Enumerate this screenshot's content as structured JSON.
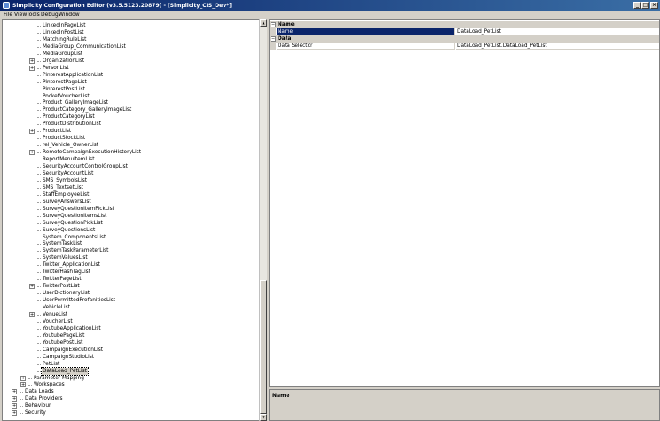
{
  "window": {
    "title": "Simplicity Configuration Editor (v3.5.5123.20879) - [Simplicity_CIS_Dev*]",
    "min": "_",
    "max": "□",
    "close": "×"
  },
  "menu": [
    "File",
    "View",
    "Tools",
    "Debug",
    "Window"
  ],
  "tree": [
    {
      "label": "LinkedInPageList",
      "indent": 4,
      "exp": false
    },
    {
      "label": "LinkedInPostList",
      "indent": 4,
      "exp": false
    },
    {
      "label": "MatchingRuleList",
      "indent": 4,
      "exp": false
    },
    {
      "label": "MediaGroup_CommunicationList",
      "indent": 4,
      "exp": false
    },
    {
      "label": "MediaGroupList",
      "indent": 4,
      "exp": false
    },
    {
      "label": "OrganizationList",
      "indent": 4,
      "exp": true
    },
    {
      "label": "PersonList",
      "indent": 4,
      "exp": true
    },
    {
      "label": "PinterestApplicationList",
      "indent": 4,
      "exp": false
    },
    {
      "label": "PinterestPageList",
      "indent": 4,
      "exp": false
    },
    {
      "label": "PinterestPostList",
      "indent": 4,
      "exp": false
    },
    {
      "label": "PocketVoucherList",
      "indent": 4,
      "exp": false
    },
    {
      "label": "Product_GalleryImageList",
      "indent": 4,
      "exp": false
    },
    {
      "label": "ProductCategory_GalleryImageList",
      "indent": 4,
      "exp": false
    },
    {
      "label": "ProductCategoryList",
      "indent": 4,
      "exp": false
    },
    {
      "label": "ProductDistributionList",
      "indent": 4,
      "exp": false
    },
    {
      "label": "ProductList",
      "indent": 4,
      "exp": true
    },
    {
      "label": "ProductStockList",
      "indent": 4,
      "exp": false
    },
    {
      "label": "rel_Vehicle_OwnerList",
      "indent": 4,
      "exp": false
    },
    {
      "label": "RemoteCampaignExecutionHistoryList",
      "indent": 4,
      "exp": true
    },
    {
      "label": "ReportMenuItemList",
      "indent": 4,
      "exp": false
    },
    {
      "label": "SecurityAccountControlGroupList",
      "indent": 4,
      "exp": false
    },
    {
      "label": "SecurityAccountList",
      "indent": 4,
      "exp": false
    },
    {
      "label": "SMS_SymbolsList",
      "indent": 4,
      "exp": false
    },
    {
      "label": "SMS_TextsetList",
      "indent": 4,
      "exp": false
    },
    {
      "label": "StaffEmployeeList",
      "indent": 4,
      "exp": false
    },
    {
      "label": "SurveyAnswersList",
      "indent": 4,
      "exp": false
    },
    {
      "label": "SurveyQuestionItemPickList",
      "indent": 4,
      "exp": false
    },
    {
      "label": "SurveyQuestionItemsList",
      "indent": 4,
      "exp": false
    },
    {
      "label": "SurveyQuestionPickList",
      "indent": 4,
      "exp": false
    },
    {
      "label": "SurveyQuestionsList",
      "indent": 4,
      "exp": false
    },
    {
      "label": "System_ComponentsList",
      "indent": 4,
      "exp": false
    },
    {
      "label": "SystemTaskList",
      "indent": 4,
      "exp": false
    },
    {
      "label": "SystemTaskParameterList",
      "indent": 4,
      "exp": false
    },
    {
      "label": "SystemValuesList",
      "indent": 4,
      "exp": false
    },
    {
      "label": "Twitter_ApplicationList",
      "indent": 4,
      "exp": false
    },
    {
      "label": "TwitterHashTagList",
      "indent": 4,
      "exp": false
    },
    {
      "label": "TwitterPageList",
      "indent": 4,
      "exp": false
    },
    {
      "label": "TwitterPostList",
      "indent": 4,
      "exp": true
    },
    {
      "label": "UserDictionaryList",
      "indent": 4,
      "exp": false
    },
    {
      "label": "UserPermittedProfanitiesList",
      "indent": 4,
      "exp": false
    },
    {
      "label": "VehicleList",
      "indent": 4,
      "exp": false
    },
    {
      "label": "VenueList",
      "indent": 4,
      "exp": true
    },
    {
      "label": "VoucherList",
      "indent": 4,
      "exp": false
    },
    {
      "label": "YoutubeApplicationList",
      "indent": 4,
      "exp": false
    },
    {
      "label": "YoutubePageList",
      "indent": 4,
      "exp": false
    },
    {
      "label": "YoutubePostList",
      "indent": 4,
      "exp": false
    },
    {
      "label": "CampaignExecutionList",
      "indent": 4,
      "exp": false
    },
    {
      "label": "CampaignStudioList",
      "indent": 4,
      "exp": false
    },
    {
      "label": "PetList",
      "indent": 4,
      "exp": false
    },
    {
      "label": "DataLoad_PetList",
      "indent": 4,
      "exp": false,
      "selected": true
    },
    {
      "label": "Parameter Mapping",
      "indent": 3,
      "exp": true
    },
    {
      "label": "Workspaces",
      "indent": 3,
      "exp": true
    },
    {
      "label": "Data Loads",
      "indent": 2,
      "exp": true
    },
    {
      "label": "Data Providers",
      "indent": 2,
      "exp": true
    },
    {
      "label": "Behaviour",
      "indent": 2,
      "exp": true
    },
    {
      "label": "Security",
      "indent": 2,
      "exp": true
    }
  ],
  "scroll": {
    "up": "▲",
    "down": "▼"
  },
  "grid": {
    "cat_name": "Name",
    "cat_data": "Data",
    "collapse_glyph": "−",
    "rows": [
      {
        "name": "Name",
        "value": "DataLoad_PetList",
        "selected": true
      },
      {
        "name": "Data Selector",
        "value": "DataLoad_PetList.DataLoad_PetList",
        "selected": false
      }
    ]
  },
  "description": {
    "title": "Name"
  },
  "glyphs": {
    "expand": "+"
  }
}
